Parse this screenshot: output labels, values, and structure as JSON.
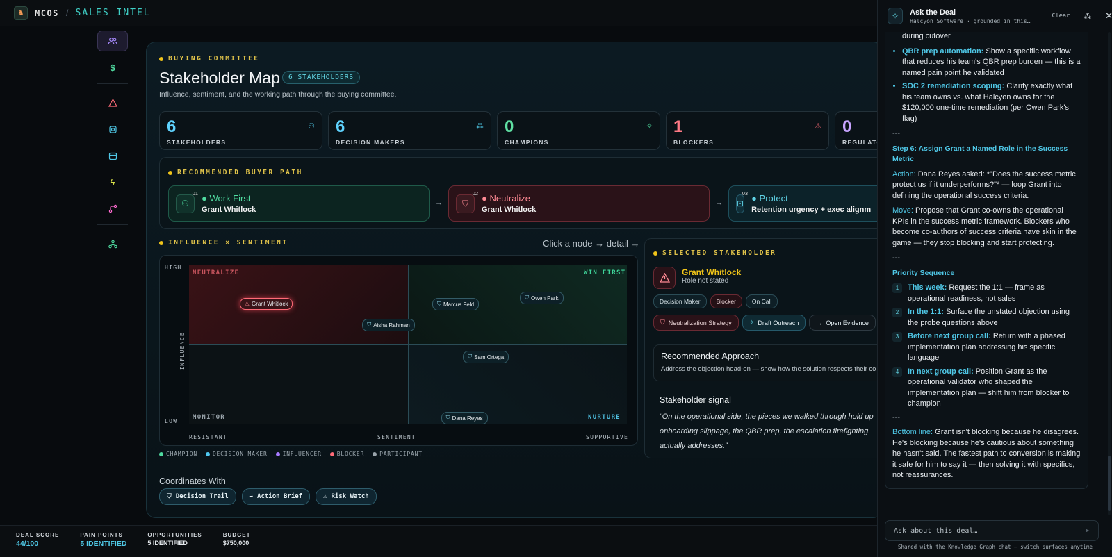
{
  "app": {
    "brand": "MCOS",
    "separator": "/",
    "product": "SALES INTEL"
  },
  "rail": {
    "items": [
      "stakeholders-icon",
      "dollar-icon",
      "alert-icon",
      "gear-icon",
      "calendar-icon",
      "bolt-icon",
      "branch-icon",
      "network-icon"
    ]
  },
  "header": {
    "eyebrow": "BUYING COMMITTEE",
    "title": "Stakeholder Map",
    "count_pill": "6 STAKEHOLDERS",
    "subtitle": "Influence, sentiment, and the working path through the buying committee."
  },
  "stats": [
    {
      "value": "6",
      "label": "STAKEHOLDERS",
      "color": "#5fd3ff"
    },
    {
      "value": "6",
      "label": "DECISION MAKERS",
      "color": "#5fd3ff"
    },
    {
      "value": "0",
      "label": "CHAMPIONS",
      "color": "#5fe0a3"
    },
    {
      "value": "1",
      "label": "BLOCKERS",
      "color": "#ff7a86"
    },
    {
      "value": "0",
      "label": "REGULATOR",
      "color": "#c8a4ff"
    }
  ],
  "path": {
    "eyebrow": "RECOMMENDED BUYER PATH",
    "steps": [
      {
        "num": "01",
        "title": "Work First",
        "name": "Grant Whitlock"
      },
      {
        "num": "02",
        "title": "Neutralize",
        "name": "Grant Whitlock"
      },
      {
        "num": "03",
        "title": "Protect",
        "name": "Retention urgency + exec alignm"
      }
    ],
    "arrow": "→"
  },
  "matrix": {
    "eyebrow": "INFLUENCE × SENTIMENT",
    "hint": "Click a node → detail →",
    "quadrants": {
      "tl": "NEUTRALIZE",
      "tr": "WIN FIRST",
      "bl": "MONITOR",
      "br": "NURTURE"
    },
    "y_high": "HIGH",
    "y_low": "LOW",
    "y_label": "INFLUENCE",
    "x_left": "RESISTANT",
    "x_mid": "SENTIMENT",
    "x_right": "SUPPORTIVE",
    "nodes": [
      {
        "name": "Grant Whitlock",
        "sentiment": 0.06,
        "influence": 0.79,
        "kind": "blocker"
      },
      {
        "name": "Aisha Rahman",
        "sentiment": 0.34,
        "influence": 0.66,
        "kind": "decision"
      },
      {
        "name": "Marcus Feld",
        "sentiment": 0.5,
        "influence": 0.79,
        "kind": "decision"
      },
      {
        "name": "Owen Park",
        "sentiment": 0.7,
        "influence": 0.83,
        "kind": "decision"
      },
      {
        "name": "Sam Ortega",
        "sentiment": 0.57,
        "influence": 0.46,
        "kind": "decision"
      },
      {
        "name": "Dana Reyes",
        "sentiment": 0.52,
        "influence": 0.07,
        "kind": "decision"
      }
    ],
    "legend": [
      "CHAMPION",
      "DECISION MAKER",
      "INFLUENCER",
      "BLOCKER",
      "PARTICIPANT"
    ],
    "legend_colors": [
      "#4fdba0",
      "#4fc8f0",
      "#a77bff",
      "#ff6b78",
      "#9aa4ab"
    ]
  },
  "selected": {
    "eyebrow": "SELECTED STAKEHOLDER",
    "name": "Grant Whitlock",
    "role": "Role not stated",
    "tags": [
      "Decision Maker",
      "Blocker",
      "On Call"
    ],
    "actions": [
      "Neutralization Strategy",
      "Draft Outreach",
      "Open Evidence"
    ],
    "approach_title": "Recommended Approach",
    "approach_text": "Address the objection head-on — show how the solution respects their co",
    "signal_title": "Stakeholder signal",
    "signal_text": "“On the operational side, the pieces we walked through hold up onboarding slippage, the QBR prep, the escalation firefighting. actually addresses.”"
  },
  "coordinates": {
    "title": "Coordinates With",
    "buttons": [
      "Decision Trail",
      "Action Brief",
      "Risk Watch"
    ]
  },
  "footer": [
    {
      "label": "DEAL SCORE",
      "value": "44/100",
      "color": "#4fc8e6"
    },
    {
      "label": "PAIN POINTS",
      "value": "5 IDENTIFIED",
      "color": "#4fc8e6"
    },
    {
      "label": "OPPORTUNITIES",
      "value": "5 IDENTIFIED",
      "color": "#e6eaee"
    },
    {
      "label": "BUDGET",
      "value": "$750,000",
      "color": "#e6eaee"
    }
  ],
  "chat": {
    "title": "Ask the Deal",
    "subtitle": "Halcyon Software · grounded in this…",
    "clear": "Clear",
    "partial_top": "during cutover",
    "bullets": [
      {
        "lead": "QBR prep automation:",
        "text": "Show a specific workflow that reduces his team's QBR prep burden — this is a named pain point he validated"
      },
      {
        "lead": "SOC 2 remediation scoping:",
        "text": "Clarify exactly what his team owns vs. what Halcyon owns for the $120,000 one-time remediation (per Owen Park's flag)"
      }
    ],
    "hr": "---",
    "step6_title": "Step 6: Assign Grant a Named Role in the Success Metric",
    "action_lead": "Action:",
    "action_text": "Dana Reyes asked: *\"Does the success metric protect us if it underperforms?\"* — loop Grant into defining the operational success criteria.",
    "move_lead": "Move:",
    "move_text": "Propose that Grant co-owns the operational KPIs in the success metric framework. Blockers who become co-authors of success criteria have skin in the game — they stop blocking and start protecting.",
    "priority_title": "Priority Sequence",
    "sequence": [
      {
        "n": "1",
        "lead": "This week:",
        "text": "Request the 1:1 — frame as operational readiness, not sales"
      },
      {
        "n": "2",
        "lead": "In the 1:1:",
        "text": "Surface the unstated objection using the probe questions above"
      },
      {
        "n": "3",
        "lead": "Before next group call:",
        "text": "Return with a phased implementation plan addressing his specific language"
      },
      {
        "n": "4",
        "lead": "In next group call:",
        "text": "Position Grant as the operational validator who shaped the implementation plan — shift him from blocker to champion"
      }
    ],
    "bottom_lead": "Bottom line:",
    "bottom_text": "Grant isn't blocking because he disagrees. He's blocking because he's cautious about something he hasn't said. The fastest path to conversion is making it safe for him to say it — then solving it with specifics, not reassurances.",
    "input_placeholder": "Ask about this deal…",
    "footnote": "Shared with the Knowledge Graph chat — switch surfaces anytime"
  }
}
